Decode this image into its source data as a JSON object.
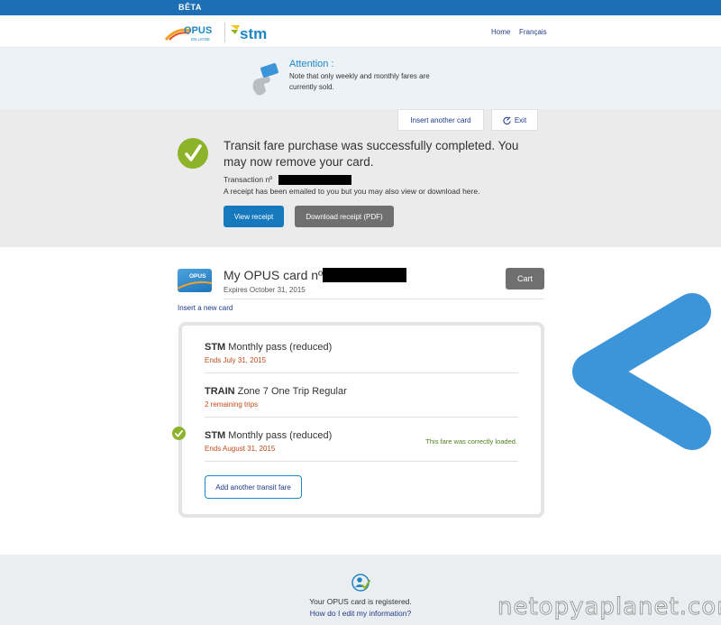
{
  "beta_label": "BÊTA",
  "header": {
    "opus_logo_text": "OPUS",
    "opus_logo_sub": "EN LIGNE",
    "stm_logo_text": "stm",
    "nav": [
      "Home",
      "Français"
    ]
  },
  "attention": {
    "title": "Attention :",
    "body": "Note that only weekly and monthly fares are currently sold."
  },
  "actions": {
    "insert_another_card": "Insert another card",
    "exit": "Exit"
  },
  "success": {
    "title": "Transit fare purchase was successfully completed. You may now remove your card.",
    "transaction_label": "Transaction nº",
    "receipt_note": "A receipt has been emailed to you but you may also view or download here.",
    "view_receipt": "View receipt",
    "download_receipt": "Download receipt (PDF)"
  },
  "card": {
    "image_label": "OPUS",
    "title": "My OPUS card nº",
    "expires": "Expires October 31, 2015",
    "cart_button": "Cart",
    "insert_new_card": "Insert a new card"
  },
  "fares": [
    {
      "operator": "STM",
      "name": "Monthly pass (reduced)",
      "detail": "Ends July 31, 2015",
      "status": ""
    },
    {
      "operator": "TRAIN",
      "name": "Zone 7 One Trip Regular",
      "detail": "2 remaining trips",
      "status": ""
    },
    {
      "operator": "STM",
      "name": "Monthly pass (reduced)",
      "detail": "Ends August 31, 2015",
      "status": "This fare was correctly loaded."
    }
  ],
  "add_fare_button": "Add another transit fare",
  "footer": {
    "registered": "Your OPUS card is registered.",
    "edit_link": "How do I edit my information?"
  },
  "watermark": "netopyaplanet.com",
  "colors": {
    "brand_blue": "#1c6fb5",
    "success_green": "#8db32a",
    "warning_orange": "#c24a1a",
    "chevron_blue": "#3d95d9"
  }
}
